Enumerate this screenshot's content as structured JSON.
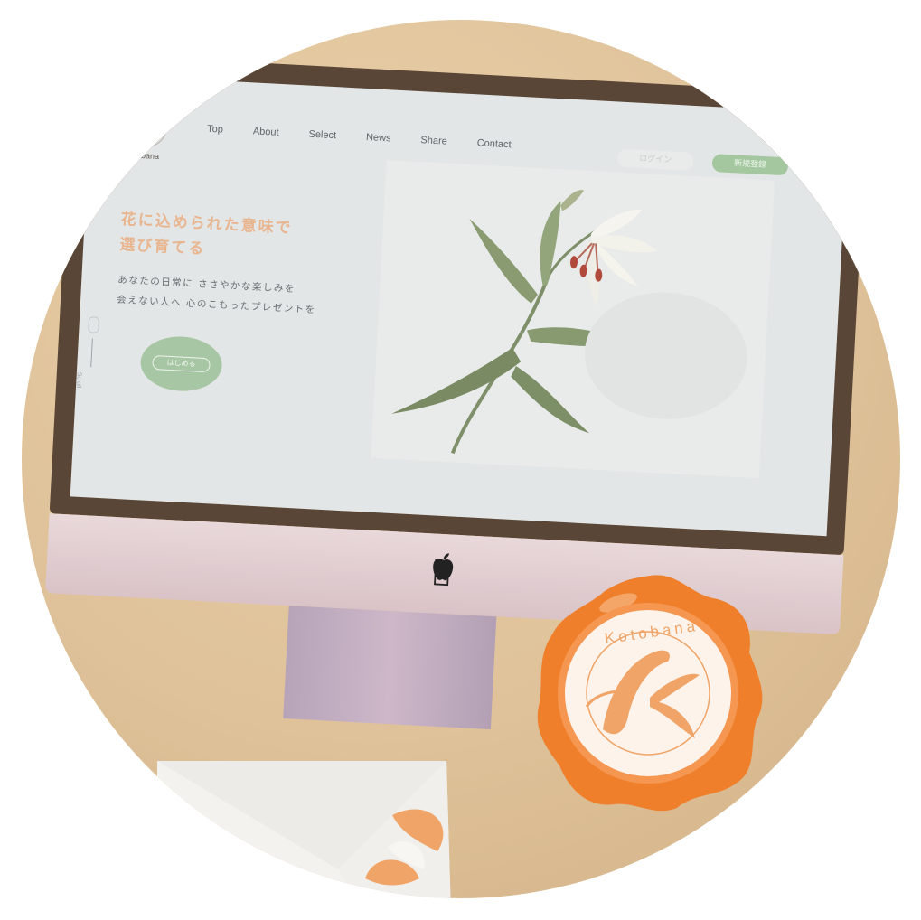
{
  "site": {
    "logo_text": "Kotobana",
    "nav": [
      "Top",
      "About",
      "Select",
      "News",
      "Share",
      "Contact"
    ],
    "login_label": "ログイン",
    "signup_label": "新規登録",
    "hero_title_line1": "花に込められた意味で",
    "hero_title_line2": "選び育てる",
    "hero_sub_line1": "あなたの日常に ささやかな楽しみを",
    "hero_sub_line2": "会えない人へ 心のこもったプレゼントを",
    "cta_label": "はじめる",
    "scroll_label": "Scroll"
  },
  "seal": {
    "ring_text": "Kotobana",
    "letter": "K"
  },
  "icons": {
    "brand": "apple-logo-icon",
    "scroll": "mouse-icon"
  },
  "colors": {
    "background": "#dfc29a",
    "bezel": "#5a4636",
    "screen": "#e3e6e7",
    "accent_orange": "#e8b58f",
    "accent_green": "#a4c7a0",
    "seal_orange": "#ef7f2b"
  }
}
